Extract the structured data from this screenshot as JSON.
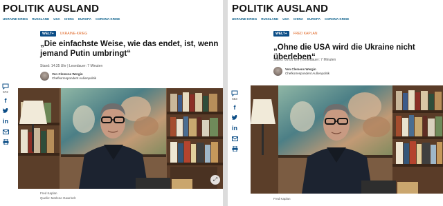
{
  "left": {
    "brand": "POLITIK AUSLAND",
    "nav": [
      "UKRAINE-KRIEG",
      "RUSSLAND",
      "USA",
      "CHINA",
      "EUROPA",
      "CORONA-KRISE"
    ],
    "tag_box": "WELT+",
    "tag_rest": "UKRAINE-KRIEG",
    "headline_line1": "„Die einfachste Weise, wie das endet, ist, wenn",
    "headline_line2": "jemand Putin umbringt“",
    "meta": "Stand: 14:35 Uhr | Lesedauer: 7 Minuten",
    "author_name": "Von Clemens Wergin",
    "author_role": "Chefkorrespondent Außenpolitik",
    "comment_count": "572",
    "caption_line1": "Fred Kaplan",
    "caption_line2": "Quelle: Marlene Gawrisch"
  },
  "right": {
    "brand": "POLITIK AUSLAND",
    "nav": [
      "UKRAINE-KRIEG",
      "RUSSLAND",
      "USA",
      "CHINA",
      "EUROPA",
      "CORONA-KRISE"
    ],
    "tag_box": "WELT+",
    "tag_rest": "FRED KAPLAN",
    "headline": "„Ohne die USA wird die Ukraine nicht überleben“",
    "meta": "Stand: 09:01 Uhr | Lesedauer: 7 Minuten",
    "author_name": "Von Clemens Wergin",
    "author_role": "Chefkorrespondent Außenpolitik",
    "comment_count": "553",
    "caption_line1": "Fred Kaplan"
  },
  "icons": [
    "comment-icon",
    "facebook-icon",
    "twitter-icon",
    "linkedin-icon",
    "mail-icon",
    "print-icon"
  ],
  "colors": {
    "nav": "#0a5f8a",
    "tag_box": "#0b4d86",
    "tag_rest": "#e06a2a",
    "icons": "#0b4d86"
  }
}
